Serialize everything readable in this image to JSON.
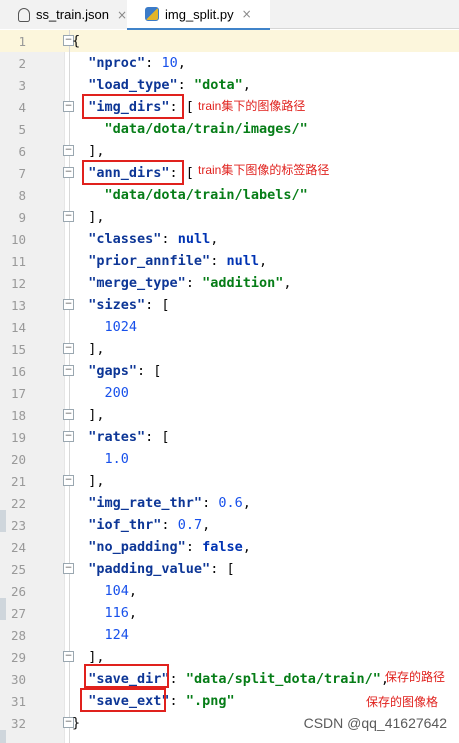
{
  "tabs": [
    {
      "label": "ss_train.json",
      "close": "×"
    },
    {
      "label": "img_split.py",
      "close": "×"
    }
  ],
  "line_numbers": [
    "1",
    "2",
    "3",
    "4",
    "5",
    "6",
    "7",
    "8",
    "9",
    "10",
    "11",
    "12",
    "13",
    "14",
    "15",
    "16",
    "17",
    "18",
    "19",
    "20",
    "21",
    "22",
    "23",
    "24",
    "25",
    "26",
    "27",
    "28",
    "29",
    "30",
    "31",
    "32"
  ],
  "code": {
    "l1": "{",
    "nproc_key": "\"nproc\"",
    "nproc_val": "10",
    "load_type_key": "\"load_type\"",
    "load_type_val": "\"dota\"",
    "img_dirs_key": "\"img_dirs\"",
    "img_dirs_val": "\"data/dota/train/images/\"",
    "ann_dirs_key": "\"ann_dirs\"",
    "ann_dirs_val": "\"data/dota/train/labels/\"",
    "classes_key": "\"classes\"",
    "classes_val": "null",
    "prior_key": "\"prior_annfile\"",
    "prior_val": "null",
    "merge_key": "\"merge_type\"",
    "merge_val": "\"addition\"",
    "sizes_key": "\"sizes\"",
    "sizes_val": "1024",
    "gaps_key": "\"gaps\"",
    "gaps_val": "200",
    "rates_key": "\"rates\"",
    "rates_val": "1.0",
    "img_rate_key": "\"img_rate_thr\"",
    "img_rate_val": "0.6",
    "iof_key": "\"iof_thr\"",
    "iof_val": "0.7",
    "no_padding_key": "\"no_padding\"",
    "no_padding_val": "false",
    "padding_value_key": "\"padding_value\"",
    "pv1": "104",
    "pv2": "116",
    "pv3": "124",
    "save_dir_key": "\"save_dir\"",
    "save_dir_val": "\"data/split_dota/train/\"",
    "save_ext_key": "\"save_ext\"",
    "save_ext_val": "\".png\"",
    "l32": "}"
  },
  "annotations": {
    "img_dirs_note": "train集下的图像路径",
    "ann_dirs_note": "train集下图像的标签路径",
    "save_dir_note": "保存的路径",
    "save_ext_note": "保存的图像格"
  },
  "watermark": "CSDN @qq_41627642",
  "colors": {
    "annotation": "#e0211d",
    "string": "#067d17",
    "number": "#1750eb",
    "keyword": "#0033b3"
  }
}
